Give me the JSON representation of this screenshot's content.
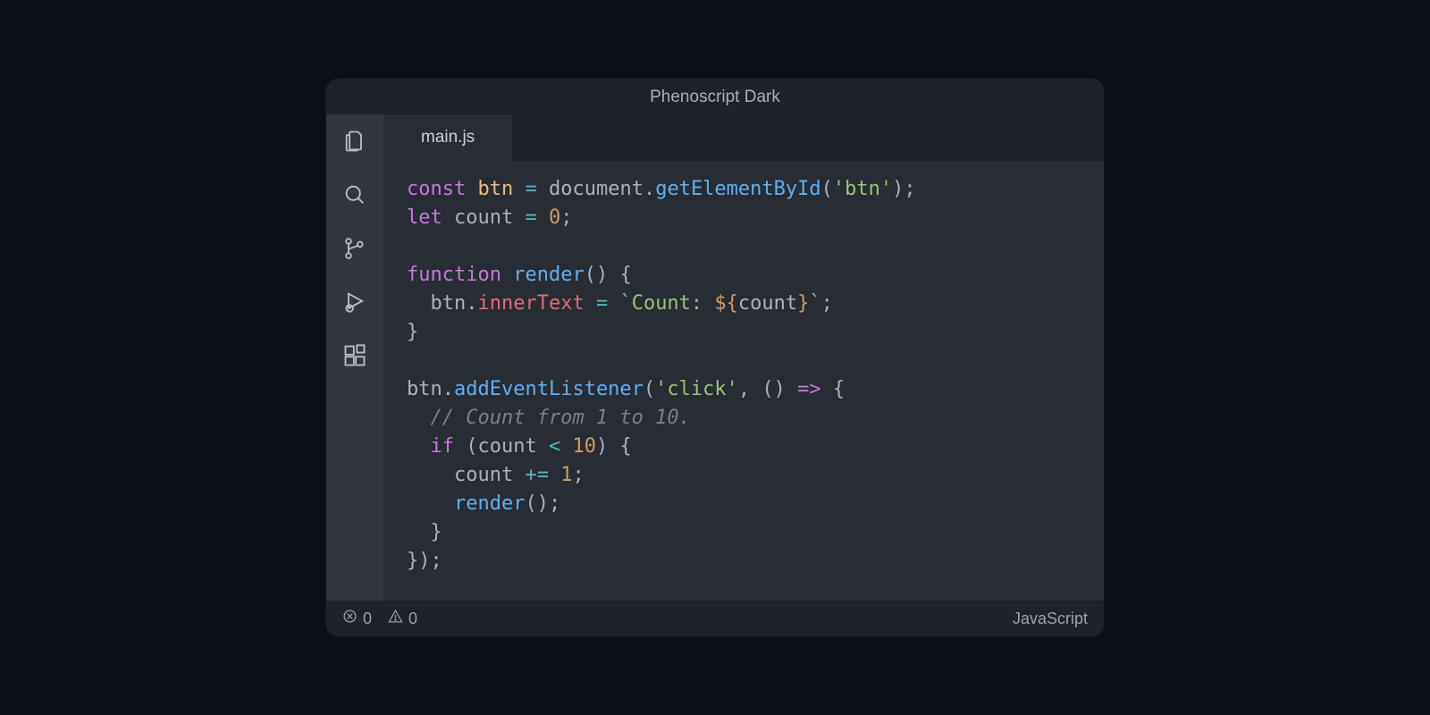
{
  "window": {
    "title": "Phenoscript Dark"
  },
  "activitybar": {
    "items": [
      {
        "name": "files-icon"
      },
      {
        "name": "search-icon"
      },
      {
        "name": "source-control-icon"
      },
      {
        "name": "run-debug-icon"
      },
      {
        "name": "extensions-icon"
      }
    ]
  },
  "tabs": [
    {
      "label": "main.js",
      "active": true
    }
  ],
  "code": {
    "lines": [
      [
        {
          "cls": "tk-kw",
          "t": "const"
        },
        {
          "cls": "tk-pun",
          "t": " "
        },
        {
          "cls": "tk-var",
          "t": "btn"
        },
        {
          "cls": "tk-pun",
          "t": " "
        },
        {
          "cls": "tk-op",
          "t": "="
        },
        {
          "cls": "tk-pun",
          "t": " "
        },
        {
          "cls": "tk-pun",
          "t": "document"
        },
        {
          "cls": "tk-pun",
          "t": "."
        },
        {
          "cls": "tk-fn",
          "t": "getElementById"
        },
        {
          "cls": "tk-pun",
          "t": "("
        },
        {
          "cls": "tk-str",
          "t": "'btn'"
        },
        {
          "cls": "tk-pun",
          "t": ");"
        }
      ],
      [
        {
          "cls": "tk-kw",
          "t": "let"
        },
        {
          "cls": "tk-pun",
          "t": " "
        },
        {
          "cls": "tk-pun",
          "t": "count"
        },
        {
          "cls": "tk-pun",
          "t": " "
        },
        {
          "cls": "tk-op",
          "t": "="
        },
        {
          "cls": "tk-pun",
          "t": " "
        },
        {
          "cls": "tk-num",
          "t": "0"
        },
        {
          "cls": "tk-pun",
          "t": ";"
        }
      ],
      [],
      [
        {
          "cls": "tk-kw",
          "t": "function"
        },
        {
          "cls": "tk-pun",
          "t": " "
        },
        {
          "cls": "tk-fn",
          "t": "render"
        },
        {
          "cls": "tk-pun",
          "t": "() {"
        }
      ],
      [
        {
          "cls": "tk-pun",
          "t": "  btn"
        },
        {
          "cls": "tk-pun",
          "t": "."
        },
        {
          "cls": "tk-prop",
          "t": "innerText"
        },
        {
          "cls": "tk-pun",
          "t": " "
        },
        {
          "cls": "tk-op",
          "t": "="
        },
        {
          "cls": "tk-pun",
          "t": " "
        },
        {
          "cls": "tk-str",
          "t": "`Count: "
        },
        {
          "cls": "tk-num",
          "t": "${"
        },
        {
          "cls": "tk-pun",
          "t": "count"
        },
        {
          "cls": "tk-num",
          "t": "}"
        },
        {
          "cls": "tk-str",
          "t": "`"
        },
        {
          "cls": "tk-pun",
          "t": ";"
        }
      ],
      [
        {
          "cls": "tk-pun",
          "t": "}"
        }
      ],
      [],
      [
        {
          "cls": "tk-pun",
          "t": "btn"
        },
        {
          "cls": "tk-pun",
          "t": "."
        },
        {
          "cls": "tk-fn",
          "t": "addEventListener"
        },
        {
          "cls": "tk-pun",
          "t": "("
        },
        {
          "cls": "tk-str",
          "t": "'click'"
        },
        {
          "cls": "tk-pun",
          "t": ", () "
        },
        {
          "cls": "tk-kw",
          "t": "=>"
        },
        {
          "cls": "tk-pun",
          "t": " {"
        }
      ],
      [
        {
          "cls": "tk-cmt",
          "t": "  // Count from 1 to 10."
        }
      ],
      [
        {
          "cls": "tk-pun",
          "t": "  "
        },
        {
          "cls": "tk-kw",
          "t": "if"
        },
        {
          "cls": "tk-pun",
          "t": " (count "
        },
        {
          "cls": "tk-op",
          "t": "<"
        },
        {
          "cls": "tk-pun",
          "t": " "
        },
        {
          "cls": "tk-num",
          "t": "10"
        },
        {
          "cls": "tk-pun",
          "t": ") {"
        }
      ],
      [
        {
          "cls": "tk-pun",
          "t": "    count "
        },
        {
          "cls": "tk-op",
          "t": "+="
        },
        {
          "cls": "tk-pun",
          "t": " "
        },
        {
          "cls": "tk-num",
          "t": "1"
        },
        {
          "cls": "tk-pun",
          "t": ";"
        }
      ],
      [
        {
          "cls": "tk-pun",
          "t": "    "
        },
        {
          "cls": "tk-fn",
          "t": "render"
        },
        {
          "cls": "tk-pun",
          "t": "();"
        }
      ],
      [
        {
          "cls": "tk-pun",
          "t": "  }"
        }
      ],
      [
        {
          "cls": "tk-pun",
          "t": "});"
        }
      ]
    ]
  },
  "statusbar": {
    "errors": "0",
    "warnings": "0",
    "language": "JavaScript"
  }
}
